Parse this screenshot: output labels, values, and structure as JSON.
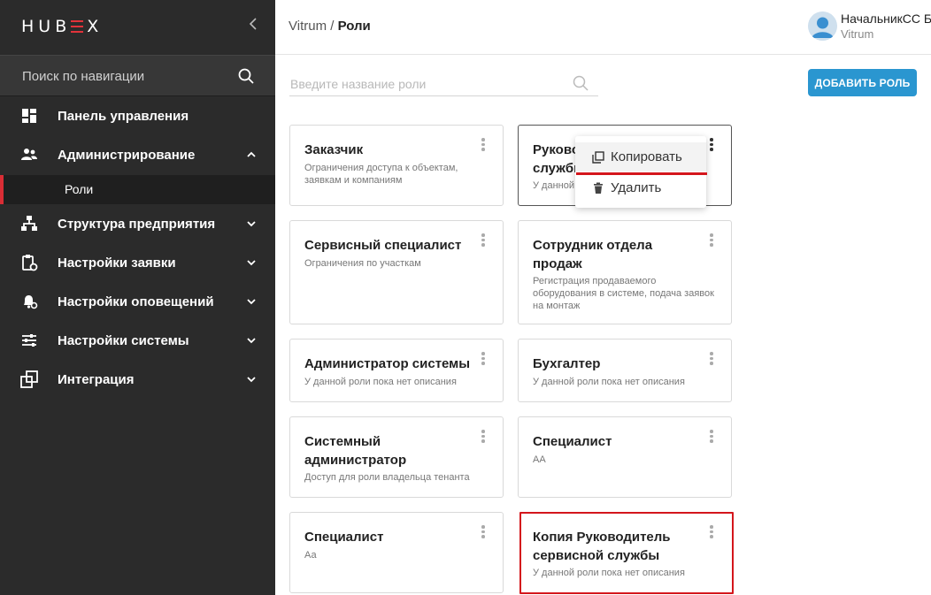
{
  "app": {
    "logo": "HUBEX",
    "collapse_icon": "chevron-left-icon"
  },
  "sidebar": {
    "search_placeholder": "Поиск по навигации",
    "items": [
      {
        "label": "Панель управления",
        "icon": "dashboard-icon",
        "chevron": ""
      },
      {
        "label": "Администрирование",
        "icon": "users-icon",
        "chevron": "up"
      },
      {
        "label": "Структура предприятия",
        "icon": "org-structure-icon",
        "chevron": "down"
      },
      {
        "label": "Настройки заявки",
        "icon": "clipboard-gear-icon",
        "chevron": "down"
      },
      {
        "label": "Настройки оповещений",
        "icon": "bell-gear-icon",
        "chevron": "down"
      },
      {
        "label": "Настройки системы",
        "icon": "sliders-icon",
        "chevron": "down"
      },
      {
        "label": "Интеграция",
        "icon": "integration-icon",
        "chevron": "down"
      }
    ],
    "sub_item": {
      "label": "Роли",
      "active": true
    }
  },
  "header": {
    "breadcrumb_parent": "Vitrum",
    "breadcrumb_sep": " / ",
    "breadcrumb_current": "Роли",
    "user_name": "НачальникСС Б",
    "user_org": "Vitrum"
  },
  "main": {
    "search_placeholder": "Введите название роли",
    "add_button": "ДОБАВИТЬ РОЛЬ",
    "roles": [
      {
        "title": "Заказчик",
        "description": "Ограничения доступа к объектам, заявкам и компаниям"
      },
      {
        "title": "Руководитель сервисной службы",
        "title_visible": "Руково службь",
        "description": "У данной роли пока нет описания",
        "description_visible": "У данной"
      },
      {
        "title": "Сервисный специалист",
        "description": "Ограничения по участкам"
      },
      {
        "title": "Сотрудник отдела продаж",
        "description": "Регистрация продаваемого оборудования в системе, подача заявок на монтаж"
      },
      {
        "title": "Администратор системы",
        "description": "У данной роли пока нет описания"
      },
      {
        "title": "Бухгалтер",
        "description": "У данной роли пока нет описания"
      },
      {
        "title": "Системный администратор",
        "description": "Доступ для роли владельца тенанта"
      },
      {
        "title": "Специалист",
        "description": "АА"
      },
      {
        "title": "Специалист",
        "description": "Аа"
      },
      {
        "title": "Копия Руководитель сервисной службы",
        "description": "У данной роли пока нет описания"
      }
    ]
  },
  "context_menu": {
    "items": [
      {
        "label": "Копировать",
        "icon": "copy-icon"
      },
      {
        "label": "Удалить",
        "icon": "trash-icon"
      }
    ]
  },
  "colors": {
    "sidebar_bg": "#2b2b2b",
    "accent_red": "#d4161c",
    "button_blue": "#2a96d0"
  }
}
